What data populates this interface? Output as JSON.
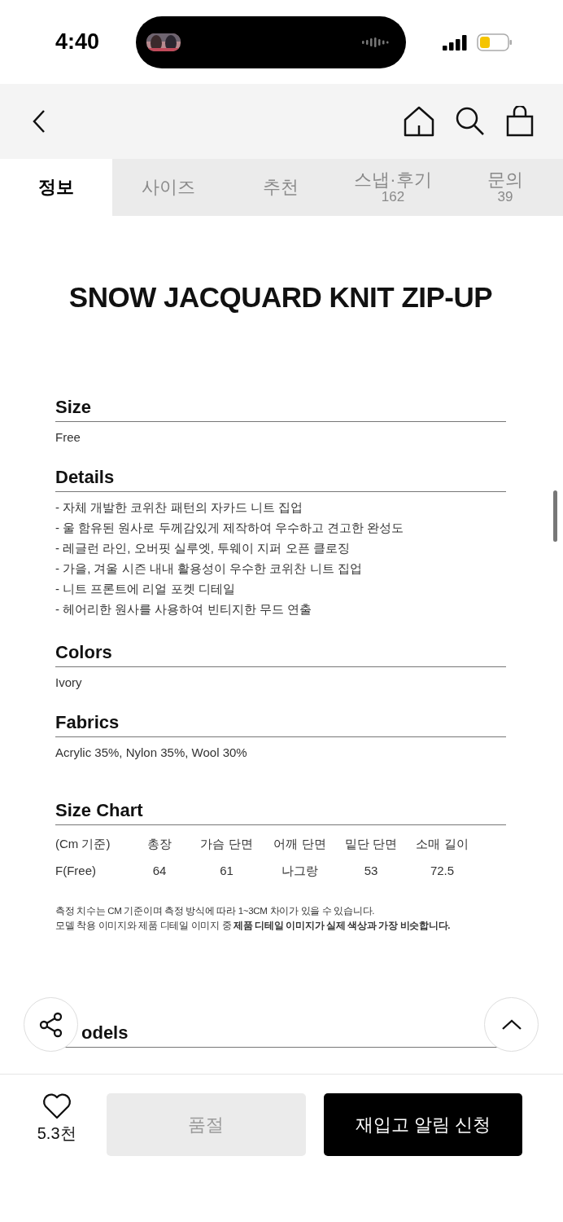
{
  "status_bar": {
    "time": "4:40"
  },
  "tabs": [
    {
      "label": "정보",
      "selected": true
    },
    {
      "label": "사이즈",
      "selected": false
    },
    {
      "label": "추천",
      "selected": false
    },
    {
      "label": "스냅·후기",
      "count": "162",
      "selected": false
    },
    {
      "label": "문의",
      "count": "39",
      "selected": false
    }
  ],
  "product": {
    "title": "SNOW JACQUARD KNIT ZIP-UP"
  },
  "sections": [
    {
      "kind": "text",
      "heading": "Size",
      "body": "Free"
    },
    {
      "kind": "list",
      "heading": "Details",
      "items": [
        "- 자체 개발한 코위찬 패턴의 자카드 니트 집업",
        "- 울 함유된 원사로 두께감있게 제작하여 우수하고 견고한 완성도",
        "- 레글런 라인, 오버핏 실루엣, 투웨이 지퍼 오픈 클로징",
        "- 가을, 겨울 시즌 내내 활용성이 우수한 코위찬 니트 집업",
        "- 니트 프론트에 리얼 포켓 디테일",
        "- 헤어리한 원사를 사용하여 빈티지한 무드 연출"
      ]
    },
    {
      "kind": "text",
      "heading": "Colors",
      "body": "Ivory"
    },
    {
      "kind": "text",
      "heading": "Fabrics",
      "body": "Acrylic 35%, Nylon 35%, Wool 30%"
    },
    {
      "kind": "table",
      "heading": "Size Chart",
      "columns": [
        "(Cm 기준)",
        "총장",
        "가슴 단면",
        "어깨 단면",
        "밑단 단면",
        "소매 길이"
      ],
      "rows": [
        [
          "F(Free)",
          "64",
          "61",
          "나그랑",
          "53",
          "72.5"
        ]
      ],
      "notes": [
        "측정 치수는 CM 기준이며 측정 방식에 따라 1~3CM 차이가 있을 수 있습니다.",
        "모델 착용 이미지와 제품 디테일 이미지 중 **제품 디테일 이미지가 실제 색상과 가장 비슷합니다.**"
      ]
    },
    {
      "kind": "partial",
      "heading": "odels"
    }
  ],
  "bottom_bar": {
    "likes": "5.3천",
    "buttons": [
      {
        "label": "품절",
        "disabled": true
      },
      {
        "label": "재입고 알림 신청",
        "disabled": false
      }
    ]
  }
}
